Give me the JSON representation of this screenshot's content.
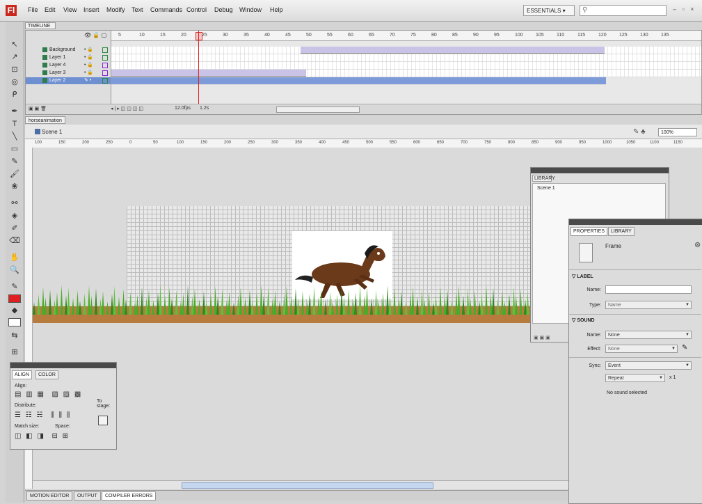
{
  "app": {
    "logo_text": "Fl"
  },
  "menu": [
    "File",
    "Edit",
    "View",
    "Insert",
    "Modify",
    "Text",
    "Commands",
    "Control",
    "Debug",
    "Window",
    "Help"
  ],
  "workspace": {
    "label": "ESSENTIALS ▾"
  },
  "search": {
    "icon": "search-icon"
  },
  "window_controls": "– ▫ ×",
  "timeline": {
    "tab": "TIMELINE",
    "ruler_labels": [
      "5",
      "10",
      "15",
      "20",
      "25",
      "30",
      "35",
      "40",
      "45",
      "50",
      "55",
      "60",
      "65",
      "70",
      "75",
      "80",
      "85",
      "90",
      "95",
      "100",
      "105",
      "110",
      "115",
      "120",
      "125",
      "130",
      "135"
    ],
    "layers": [
      {
        "name": "Background",
        "status": "• 🔒"
      },
      {
        "name": "Layer 1",
        "status": "• 🔒"
      },
      {
        "name": "Layer 4",
        "status": "• 🔒"
      },
      {
        "name": "Layer 3",
        "status": "• 🔒"
      },
      {
        "name": "Layer 2",
        "status": "✎ •"
      }
    ],
    "footer": {
      "icons": "▣ ▣ 🗑",
      "controls": "◂ | ▸ ◫ ◫ ◫ ◫",
      "fps": "12.0fps",
      "time": "1.2s"
    }
  },
  "document": {
    "tab": "horseanimation ×",
    "scene": "Scene 1",
    "zoom": "100%"
  },
  "hruler_labels": [
    "100",
    "150",
    "200",
    "250",
    "0",
    "50",
    "100",
    "150",
    "200",
    "250",
    "300",
    "350",
    "400",
    "450",
    "500",
    "550",
    "600",
    "650",
    "700",
    "750",
    "800",
    "850",
    "900",
    "950",
    "1000",
    "1050",
    "1100",
    "1150"
  ],
  "bottom_tabs": [
    "MOTION EDITOR",
    "OUTPUT",
    "COMPILER ERRORS"
  ],
  "library": {
    "tab": "LIBRARY",
    "item": "Scene 1",
    "footer": "▣ ▣ ▣"
  },
  "properties": {
    "tabs": [
      "PROPERTIES",
      "LIBRARY"
    ],
    "frame_label": "Frame",
    "sections": {
      "label": "▽ LABEL",
      "sound": "▽ SOUND"
    },
    "fields": {
      "name_label": "Name:",
      "type_label": "Type:",
      "type_value": "Name",
      "sound_name_label": "Name:",
      "sound_name_value": "None",
      "effect_label": "Effect:",
      "effect_value": "None",
      "sync_label": "Sync:",
      "sync_value": "Event",
      "repeat_value": "Repeat",
      "repeat_count": "x 1",
      "no_sound": "No sound selected"
    }
  },
  "align": {
    "tabs": [
      "ALIGN",
      "COLOR"
    ],
    "align_label": "Align:",
    "distribute_label": "Distribute:",
    "match_label": "Match size:",
    "space_label": "Space:",
    "to_stage": "To stage:"
  },
  "colors": {
    "accent": "#6e8fd0",
    "tween": "#c9c3e8",
    "playhead": "#e02020",
    "ground": "#b77c3d",
    "grass": "#4caa2a",
    "horse": "#6b3a1a"
  }
}
